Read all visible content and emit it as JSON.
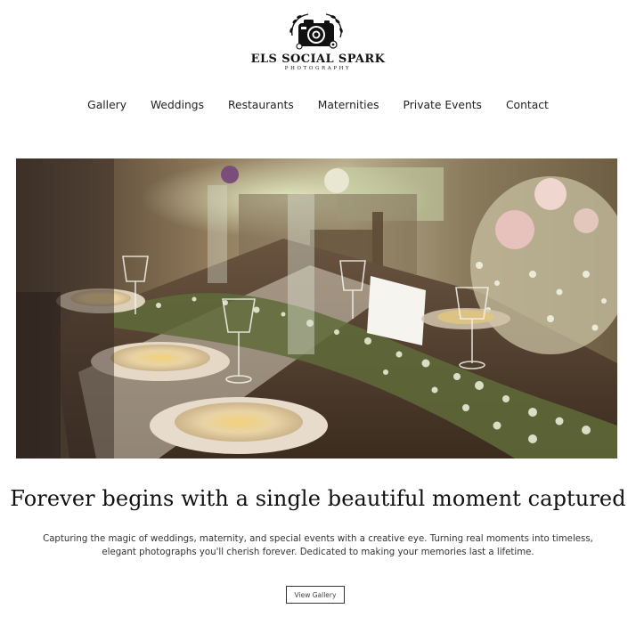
{
  "brand": {
    "name": "ELS SOCIAL SPARK",
    "subtitle": "PHOTOGRAPHY",
    "logo_icon": "camera-icon"
  },
  "nav": {
    "items": [
      {
        "label": "Gallery"
      },
      {
        "label": "Weddings"
      },
      {
        "label": "Restaurants"
      },
      {
        "label": "Maternities"
      },
      {
        "label": "Private Events"
      },
      {
        "label": "Contact"
      }
    ]
  },
  "hero": {
    "image": "wedding-table-photo"
  },
  "main": {
    "headline": "Forever begins with a single beautiful moment captured",
    "tagline": "Capturing the magic of weddings, maternity, and special events with a creative eye. Turning real moments into timeless, elegant photographs you'll cherish forever. Dedicated to making your memories last a lifetime.",
    "cta_label": "View Gallery"
  },
  "colors": {
    "background": "#ffffff",
    "text": "#222222",
    "button_border": "#333333"
  }
}
